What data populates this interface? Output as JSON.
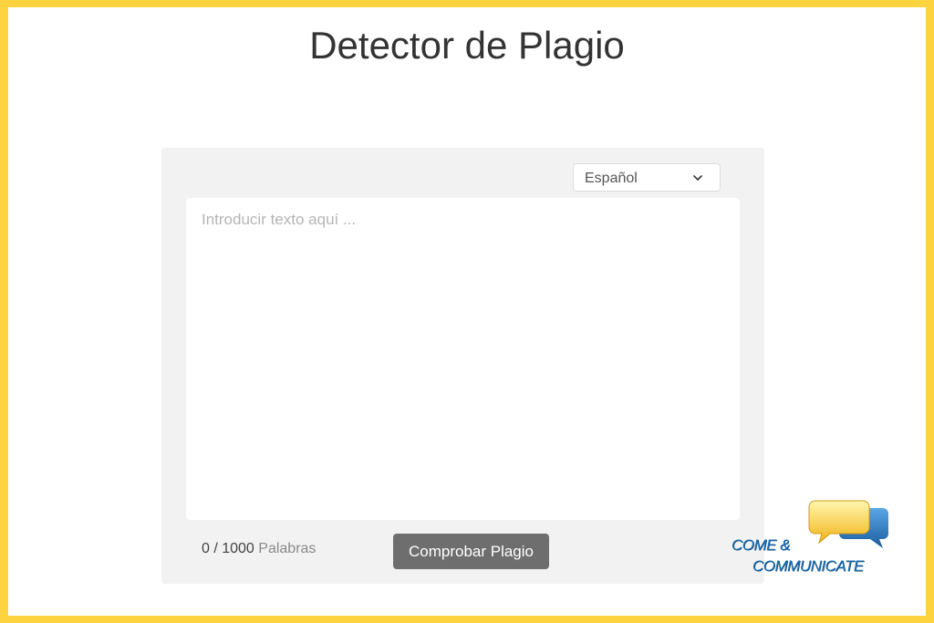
{
  "page": {
    "title": "Detector de Plagio"
  },
  "language_select": {
    "selected": "Español",
    "icon": "chevron-down-icon"
  },
  "text_input": {
    "value": "",
    "placeholder": "Introducir texto aquí ..."
  },
  "counter": {
    "count": "0 / 1000",
    "unit": "Palabras"
  },
  "check_button": {
    "label": "Comprobar Plagio"
  },
  "logo": {
    "line1": "COME &",
    "line2": "COMMUNICATE",
    "icon": "speech-bubbles-icon"
  },
  "colors": {
    "border": "#fdd33f",
    "panel": "#f2f2f2",
    "button": "#6e6e6e",
    "logo_text": "#1b6fb5"
  }
}
